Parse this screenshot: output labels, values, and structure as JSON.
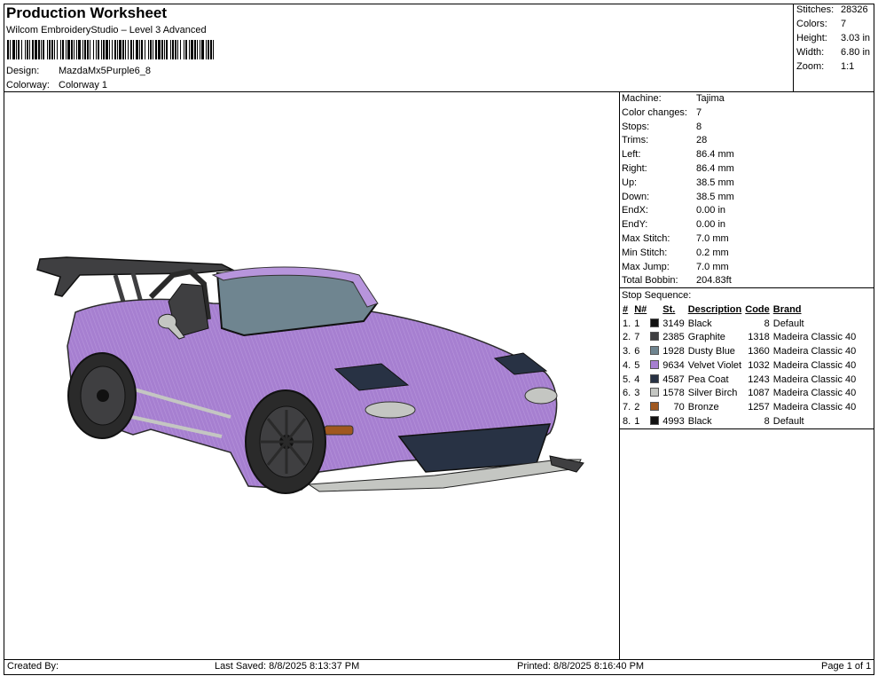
{
  "header": {
    "title": "Production Worksheet",
    "subtitle": "Wilcom EmbroideryStudio – Level 3 Advanced",
    "design_label": "Design:",
    "design_value": "MazdaMx5Purple6_8",
    "colorway_label": "Colorway:",
    "colorway_value": "Colorway 1"
  },
  "summary": [
    {
      "label": "Stitches:",
      "value": "28326"
    },
    {
      "label": "Colors:",
      "value": "7"
    },
    {
      "label": "Height:",
      "value": "3.03 in"
    },
    {
      "label": "Width:",
      "value": "6.80 in"
    },
    {
      "label": "Zoom:",
      "value": "1:1"
    }
  ],
  "machine_info": [
    {
      "label": "Machine:",
      "value": "Tajima"
    },
    {
      "label": "Color changes:",
      "value": "7"
    },
    {
      "label": "Stops:",
      "value": "8"
    },
    {
      "label": "Trims:",
      "value": "28"
    },
    {
      "label": "Left:",
      "value": "86.4 mm"
    },
    {
      "label": "Right:",
      "value": "86.4 mm"
    },
    {
      "label": "Up:",
      "value": "38.5 mm"
    },
    {
      "label": "Down:",
      "value": "38.5 mm"
    },
    {
      "label": "EndX:",
      "value": "0.00 in"
    },
    {
      "label": "EndY:",
      "value": "0.00 in"
    },
    {
      "label": "Max Stitch:",
      "value": "7.0 mm"
    },
    {
      "label": "Min Stitch:",
      "value": "0.2 mm"
    },
    {
      "label": "Max Jump:",
      "value": "7.0 mm"
    },
    {
      "label": "Total Bobbin:",
      "value": "204.83ft"
    }
  ],
  "stop_sequence": {
    "title": "Stop Sequence:",
    "columns": [
      "#",
      "N#",
      "St.",
      "Description",
      "Code",
      "Brand"
    ],
    "rows": [
      {
        "idx": "1.",
        "n": "1",
        "color": "#111111",
        "st": "3149",
        "desc": "Black",
        "code": "8",
        "brand": "Default"
      },
      {
        "idx": "2.",
        "n": "7",
        "color": "#3f3f41",
        "st": "2385",
        "desc": "Graphite",
        "code": "1318",
        "brand": "Madeira Classic 40"
      },
      {
        "idx": "3.",
        "n": "6",
        "color": "#6f8590",
        "st": "1928",
        "desc": "Dusty Blue",
        "code": "1360",
        "brand": "Madeira Classic 40"
      },
      {
        "idx": "4.",
        "n": "5",
        "color": "#a67fd0",
        "st": "9634",
        "desc": "Velvet Violet",
        "code": "1032",
        "brand": "Madeira Classic 40"
      },
      {
        "idx": "5.",
        "n": "4",
        "color": "#283244",
        "st": "4587",
        "desc": "Pea Coat",
        "code": "1243",
        "brand": "Madeira Classic 40"
      },
      {
        "idx": "6.",
        "n": "3",
        "color": "#c4c6c2",
        "st": "1578",
        "desc": "Silver Birch",
        "code": "1087",
        "brand": "Madeira Classic 40"
      },
      {
        "idx": "7.",
        "n": "2",
        "color": "#a0581f",
        "st": "70",
        "desc": "Bronze",
        "code": "1257",
        "brand": "Madeira Classic 40"
      },
      {
        "idx": "8.",
        "n": "1",
        "color": "#111111",
        "st": "4993",
        "desc": "Black",
        "code": "8",
        "brand": "Default"
      }
    ]
  },
  "footer": {
    "created_by": "Created By:",
    "last_saved": "Last Saved: 8/8/2025 8:13:37 PM",
    "printed": "Printed: 8/8/2025 8:16:40 PM",
    "page": "Page 1 of 1"
  },
  "colors": {
    "body_purple": "#a67fd0",
    "dark_purple": "#7d5aa6",
    "graphite": "#3f3f41",
    "dusty_blue": "#6f8590",
    "silver": "#c4c6c2",
    "bronze": "#a0581f"
  }
}
